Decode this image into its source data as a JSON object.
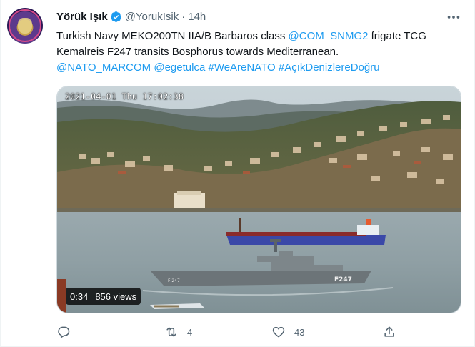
{
  "user": {
    "name": "Yörük Işık",
    "handle": "@YorukIsik",
    "separator": "·",
    "time": "14h",
    "verified": true
  },
  "tweet": {
    "line1_text": "Turkish Navy MEKO200TN IIA/B Barbaros class ",
    "line1_mention": "@COM_SNMG2",
    "line1_tail": " frigate TCG",
    "line2": "Kemalreis F247 transits Bosphorus towards Mediterranean.",
    "line3_tags": [
      "@NATO_MARCOM",
      "@egetulca",
      "#WeAreNATO",
      "#AçıkDenizlereDoğru"
    ]
  },
  "media": {
    "timestamp": "2021-04-01 Thu 17:02:38",
    "duration": "0:34",
    "views": "856 views",
    "ship_hull_number_primary": "F247",
    "ship_hull_number_bow": "F 247"
  },
  "actions": {
    "reply_count": "",
    "retweet_count": "4",
    "like_count": "43"
  },
  "colors": {
    "accent": "#1d9bf0",
    "secondary_text": "#536471",
    "primary_text": "#0f1419"
  },
  "icons": [
    "verified-badge-icon",
    "more-icon",
    "reply-icon",
    "retweet-icon",
    "like-icon",
    "share-icon"
  ]
}
